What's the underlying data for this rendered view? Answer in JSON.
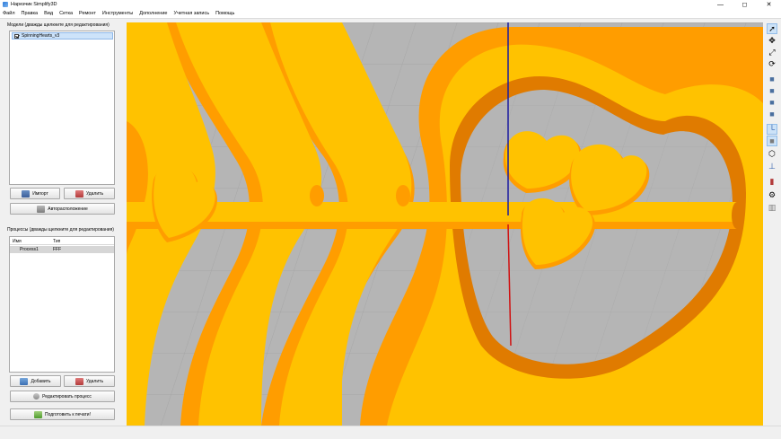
{
  "window": {
    "title": "Нарезчик Simplify3D"
  },
  "window_controls": {
    "minimize": "—",
    "maximize": "◻",
    "close": "✕"
  },
  "menu": [
    "Файл",
    "Правка",
    "Вид",
    "Сетка",
    "Ремонт",
    "Инструменты",
    "Дополнение",
    "Учетная запись",
    "Помощь"
  ],
  "models": {
    "label": "Модели (дважды щелкните для редактирования)",
    "items": [
      {
        "name": "SpinningHearts_v3",
        "checked": true
      }
    ],
    "import_button": "Импорт",
    "delete_button": "Удалить",
    "autoarrange_button": "Авторасположение"
  },
  "processes": {
    "label": "Процессы (дважды щелкните для редактирования)",
    "columns": [
      "Имя",
      "Тип"
    ],
    "rows": [
      {
        "name": "Process1",
        "type": "FFF"
      }
    ],
    "add_button": "Добавить",
    "delete_button": "Удалить",
    "edit_button": "Редактировать процесс",
    "prepare_button": "Подготовить к печати!"
  },
  "colors": {
    "model": "#ffc200",
    "model_shade": "#ff9d00",
    "model_edge": "#e07b00",
    "bed": "#b5b5b5",
    "axis_z": "#1a1aa0",
    "axis_x": "#d01010"
  },
  "toolbar_icons": [
    "select-icon",
    "move-icon",
    "scale-icon",
    "rotate-icon",
    "view-front-icon",
    "view-top-icon",
    "view-side-icon",
    "view-iso-icon",
    "axes-icon",
    "cube-icon",
    "wireframe-icon",
    "support-icon",
    "cut-icon",
    "settings-icon",
    "layers-icon"
  ]
}
